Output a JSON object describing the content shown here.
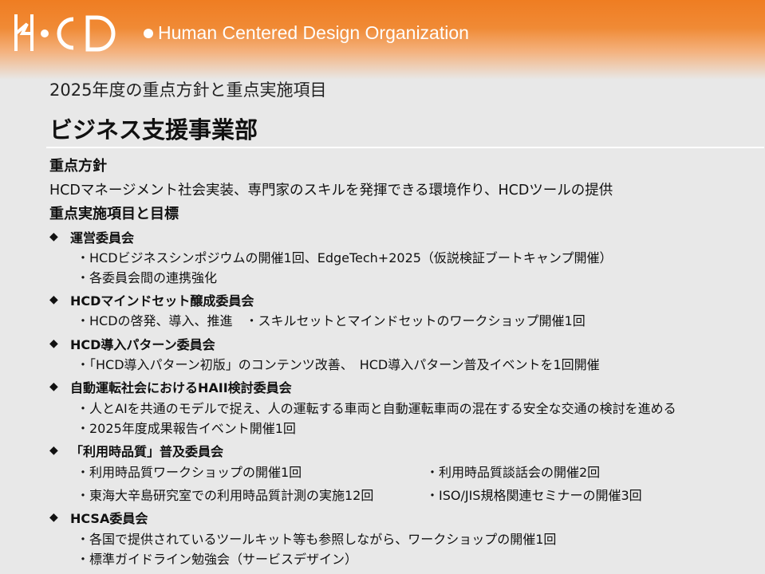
{
  "header": {
    "logo_text": "HCD",
    "org_name": "Human Centered Design Organization"
  },
  "subtitle": "2025年度の重点方針と重点実施項目",
  "title": "ビジネス支援事業部",
  "policy_heading": "重点方針",
  "policy_text": "HCDマネージメント社会実装、専門家のスキルを発揮できる環境作り、HCDツールの提供",
  "items_heading": "重点実施項目と目標",
  "committees": [
    {
      "name": "運営委員会",
      "items": [
        "・HCDビジネスシンポジウムの開催1回、EdgeTech+2025（仮説検証ブートキャンプ開催）",
        "・各委員会間の連携強化"
      ]
    },
    {
      "name": "HCDマインドセット醸成委員会",
      "items": [
        "・HCDの啓発、導入、推進　・スキルセットとマインドセットのワークショップ開催1回"
      ]
    },
    {
      "name": "HCD導入パターン委員会",
      "items": [
        "・「HCD導入パターン初版」のコンテンツ改善、　HCD導入パターン普及イベントを1回開催"
      ]
    },
    {
      "name": "自動運転社会におけるHAII検討委員会",
      "items": [
        "・人とAIを共通のモデルで捉え、人の運転する車両と自動運転車両の混在する安全な交通の検討を進める",
        "・2025年度成果報告イベント開催1回"
      ]
    },
    {
      "name": "「利用時品質」普及委員会",
      "items": [
        "・利用時品質ワークショップの開催1回",
        "・利用時品質談話会の開催2回",
        "・東海大辛島研究室での利用時品質計測の実施12回",
        "・ISO/JIS規格関連セミナーの開催3回"
      ]
    },
    {
      "name": "HCSA委員会",
      "items": [
        "・各国で提供されているツールキット等も参照しながら、ワークショップの開催1回",
        "・標準ガイドライン勉強会（サービスデザイン）"
      ]
    }
  ],
  "bullet_symbol": "◆"
}
